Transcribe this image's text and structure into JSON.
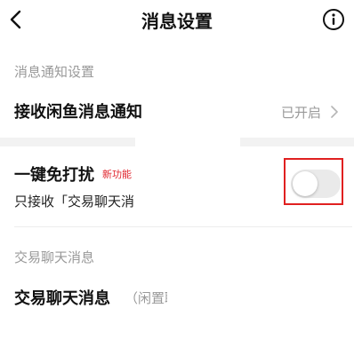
{
  "header": {
    "title": "消息设置",
    "back_icon": "chevron-left-icon",
    "info_icon": "info-circle-icon"
  },
  "notification_section": {
    "label": "消息通知设置",
    "rows": [
      {
        "title": "接收闲鱼消息通知",
        "status": "已开启"
      }
    ]
  },
  "dnd_section": {
    "title": "一键免打扰",
    "badge": "新功能",
    "subtext": "只接收「交易聊天消",
    "toggle_on": false
  },
  "trade_section": {
    "label": "交易聊天消息",
    "rows": [
      {
        "title": "交易聊天消息",
        "status": "（闲置聊"
      }
    ]
  },
  "colors": {
    "highlight_border": "#e02020",
    "badge_red": "#e0242c",
    "muted_text": "#999999",
    "section_band": "#f2f2f2"
  }
}
